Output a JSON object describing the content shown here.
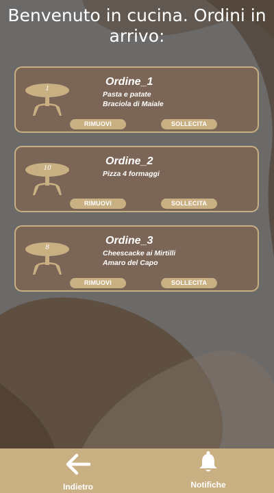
{
  "header": {
    "title": "Benvenuto in cucina. Ordini in arrivo:"
  },
  "orders": [
    {
      "title": "Ordine_1",
      "table": "1",
      "items": [
        "Pasta e patate",
        "Braciola di Maiale"
      ],
      "remove_label": "RIMUOVI",
      "urge_label": "SOLLECITA"
    },
    {
      "title": "Ordine_2",
      "table": "10",
      "items": [
        "Pizza 4 formaggi"
      ],
      "remove_label": "RIMUOVI",
      "urge_label": "SOLLECITA"
    },
    {
      "title": "Ordine_3",
      "table": "8",
      "items": [
        "Cheescacke ai Mirtilli",
        "Amaro del Capo"
      ],
      "remove_label": "RIMUOVI",
      "urge_label": "SOLLECITA"
    }
  ],
  "footer": {
    "back_label": "Indietro",
    "notifications_label": "Notifiche"
  },
  "icons": {
    "back": "arrow-left-icon",
    "notifications": "bell-icon",
    "table": "table-icon"
  },
  "colors": {
    "accent": "#c9b083",
    "card": "#7a6556",
    "background": "#6b6a69"
  }
}
